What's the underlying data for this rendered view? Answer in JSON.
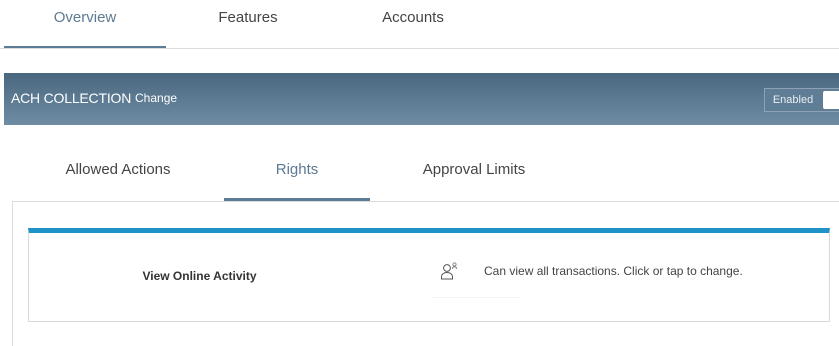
{
  "top_tabs": [
    {
      "label": "Overview",
      "active": true
    },
    {
      "label": "Features",
      "active": false
    },
    {
      "label": "Accounts",
      "active": false
    }
  ],
  "service": {
    "name": "ACH COLLECTION",
    "change_label": "Change",
    "status_label": "Enabled"
  },
  "sub_tabs": [
    {
      "label": "Allowed Actions",
      "active": false
    },
    {
      "label": "Rights",
      "active": true
    },
    {
      "label": "Approval Limits",
      "active": false
    }
  ],
  "rights": [
    {
      "name": "View Online Activity",
      "icon": "user-roles-icon",
      "description": "Can view all transactions. Click  or tap to change."
    }
  ],
  "colors": {
    "active_tab": "#5c7a93",
    "banner": "#5a7890",
    "card_accent": "#1f93c8"
  }
}
